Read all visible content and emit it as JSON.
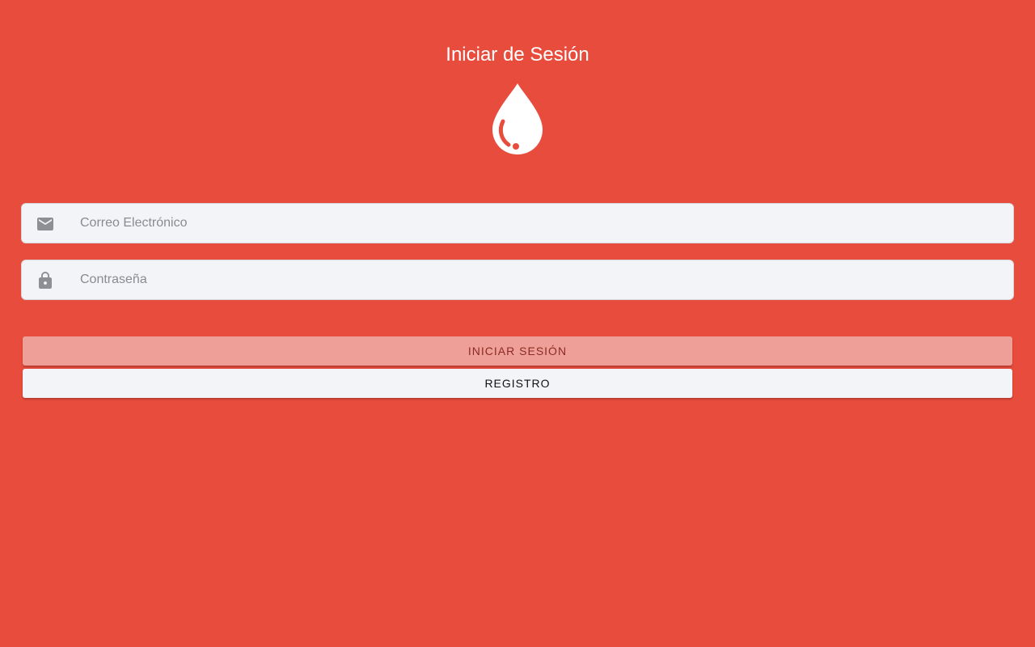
{
  "header": {
    "title": "Iniciar de Sesión",
    "logo_icon": "blood-drop-icon"
  },
  "form": {
    "email": {
      "icon": "mail-icon",
      "placeholder": "Correo Electrónico",
      "value": ""
    },
    "password": {
      "icon": "lock-icon",
      "placeholder": "Contraseña",
      "value": ""
    }
  },
  "actions": {
    "login_label": "INICIAR SESIÓN",
    "register_label": "REGISTRO"
  },
  "colors": {
    "background": "#e84c3d",
    "field_background": "#f3f4f8",
    "login_button": "#eea098",
    "register_button": "#f3f4f8"
  }
}
